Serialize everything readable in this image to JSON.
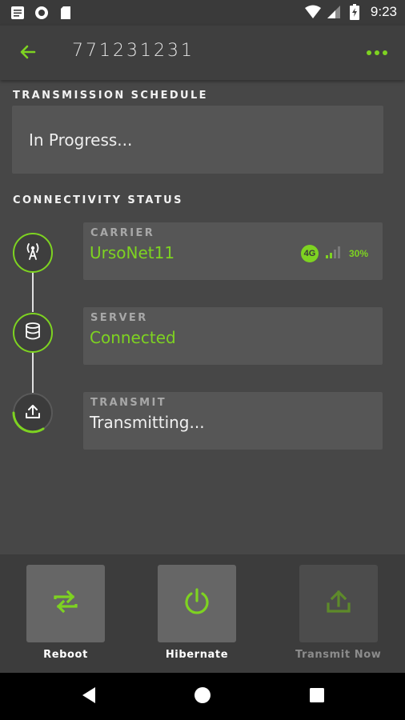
{
  "status_bar": {
    "time": "9:23",
    "left_icons": [
      "notification-list-icon",
      "record-icon",
      "sd-card-icon"
    ],
    "right_icons": [
      "wifi-icon",
      "cell-signal-icon",
      "battery-charging-icon"
    ]
  },
  "app_bar": {
    "title": "771231231",
    "back_icon": "arrow-left-icon",
    "more_icon": "more-horizontal-icon"
  },
  "schedule": {
    "section_title": "TRANSMISSION SCHEDULE",
    "status": "In Progress..."
  },
  "connectivity": {
    "section_title": "CONNECTIVITY STATUS",
    "carrier": {
      "label": "CARRIER",
      "value": "UrsoNet11",
      "network_badge": "4G",
      "signal_percent": "30%",
      "icon": "antenna-icon"
    },
    "server": {
      "label": "SERVER",
      "value": "Connected",
      "icon": "database-icon"
    },
    "transmit": {
      "label": "TRANSMIT",
      "value": "Transmitting...",
      "icon": "upload-icon"
    }
  },
  "actions": [
    {
      "label": "Reboot",
      "icon": "swap-arrows-icon",
      "enabled": true
    },
    {
      "label": "Hibernate",
      "icon": "power-icon",
      "enabled": true
    },
    {
      "label": "Transmit Now",
      "icon": "upload-icon",
      "enabled": false
    }
  ],
  "nav_bar": {
    "back_icon": "nav-back-icon",
    "home_icon": "nav-home-icon",
    "recents_icon": "nav-recents-icon"
  },
  "colors": {
    "accent": "#7ed321",
    "background": "#474747",
    "card": "#555555"
  }
}
